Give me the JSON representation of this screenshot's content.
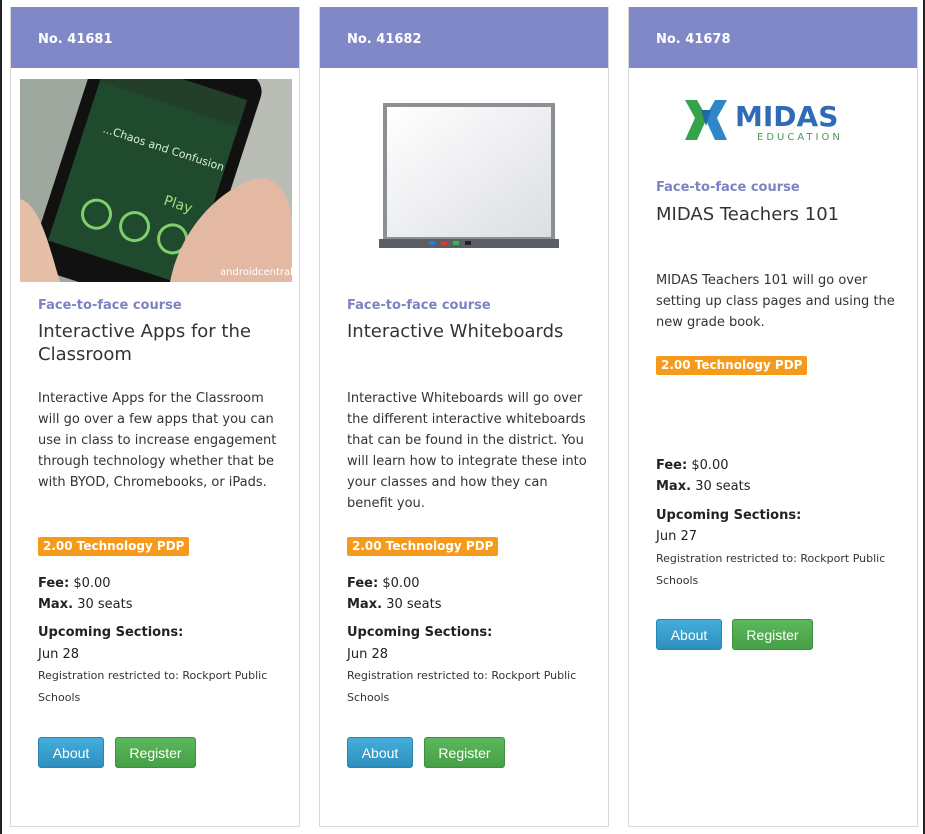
{
  "colors": {
    "header": "#8088c8",
    "type_text": "#7d83c2",
    "badge": "#f59a1a",
    "about_button": "#2e8fbf",
    "register_button": "#46a046"
  },
  "cards": [
    {
      "number": "No. 41681",
      "image": "phone-app-screenshot",
      "image_text": {
        "line1": "...Chaos and Confusion",
        "line2": "Play",
        "watermark": "androidcentral"
      },
      "type": "Face-to-face course",
      "title": "Interactive Apps for the Classroom",
      "description": "Interactive Apps for the Classroom will go over a few apps that you can use in class to increase engagement through technology whether that be with BYOD, Chromebooks, or iPads.",
      "badge": "2.00 Technology PDP",
      "fee_label": "Fee:",
      "fee_value": "$0.00",
      "max_label": "Max.",
      "max_value": "30 seats",
      "upcoming_label": "Upcoming Sections:",
      "date": "Jun 28",
      "restricted": "Registration restricted to: Rockport Public Schools",
      "about_label": "About",
      "register_label": "Register"
    },
    {
      "number": "No. 41682",
      "image": "interactive-whiteboard",
      "type": "Face-to-face course",
      "title": "Interactive Whiteboards",
      "description": "Interactive Whiteboards will go over the different interactive whiteboards that can be found in the district. You will learn how to integrate these into your classes and how they can benefit you.",
      "badge": "2.00 Technology PDP",
      "fee_label": "Fee:",
      "fee_value": "$0.00",
      "max_label": "Max.",
      "max_value": "30 seats",
      "upcoming_label": "Upcoming Sections:",
      "date": "Jun 28",
      "restricted": "Registration restricted to: Rockport Public Schools",
      "about_label": "About",
      "register_label": "Register"
    },
    {
      "number": "No. 41678",
      "image": "midas-education-logo",
      "logo_main": "MIDAS",
      "logo_sub": "EDUCATION",
      "type": "Face-to-face course",
      "title": "MIDAS Teachers 101",
      "description": "MIDAS Teachers 101 will go over setting up class pages and using the new grade book.",
      "badge": "2.00 Technology PDP",
      "fee_label": "Fee:",
      "fee_value": "$0.00",
      "max_label": "Max.",
      "max_value": "30 seats",
      "upcoming_label": "Upcoming Sections:",
      "date": "Jun 27",
      "restricted": "Registration restricted to: Rockport Public Schools",
      "about_label": "About",
      "register_label": "Register"
    }
  ]
}
